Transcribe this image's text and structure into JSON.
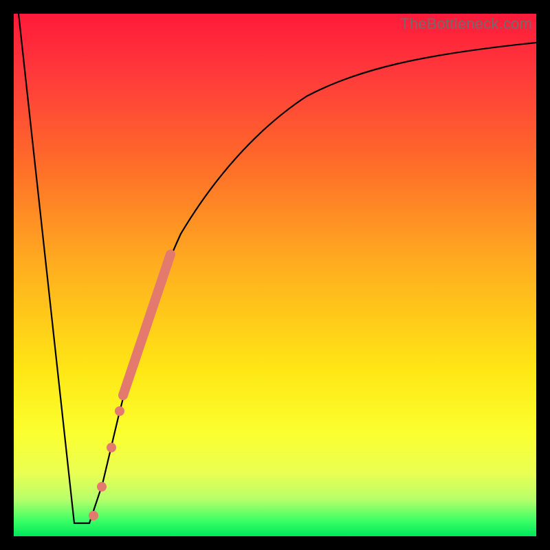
{
  "watermark": "TheBottleneck.com",
  "colors": {
    "dot": "#e47a6e",
    "curve": "#000000"
  },
  "chart_data": {
    "type": "line",
    "title": "",
    "xlabel": "",
    "ylabel": "",
    "xlim": [
      0,
      100
    ],
    "ylim": [
      0,
      100
    ],
    "grid": false,
    "legend": false,
    "background_gradient": {
      "top": "#ff1a3a",
      "mid": "#ffe615",
      "bottom": "#00e85a"
    },
    "series": [
      {
        "name": "left-descent",
        "x": [
          1,
          11.5
        ],
        "y": [
          100,
          2.5
        ]
      },
      {
        "name": "floor",
        "x": [
          11.5,
          14.5
        ],
        "y": [
          2.5,
          2.5
        ]
      },
      {
        "name": "right-ascent",
        "x": [
          14.5,
          17,
          20,
          23,
          27,
          32,
          38,
          46,
          56,
          70,
          85,
          100
        ],
        "y": [
          2.5,
          10,
          23,
          35,
          47,
          58,
          68,
          76,
          83,
          89,
          92.5,
          94.5
        ]
      }
    ],
    "highlight_segment": {
      "name": "thick-salmon-band",
      "x": [
        21,
        30
      ],
      "y": [
        27,
        54
      ]
    },
    "points": [
      {
        "x": 15.0,
        "y": 4.0,
        "r": 7
      },
      {
        "x": 16.8,
        "y": 9.5,
        "r": 7
      },
      {
        "x": 18.7,
        "y": 17.0,
        "r": 7
      },
      {
        "x": 20.3,
        "y": 24.0,
        "r": 7
      }
    ]
  }
}
